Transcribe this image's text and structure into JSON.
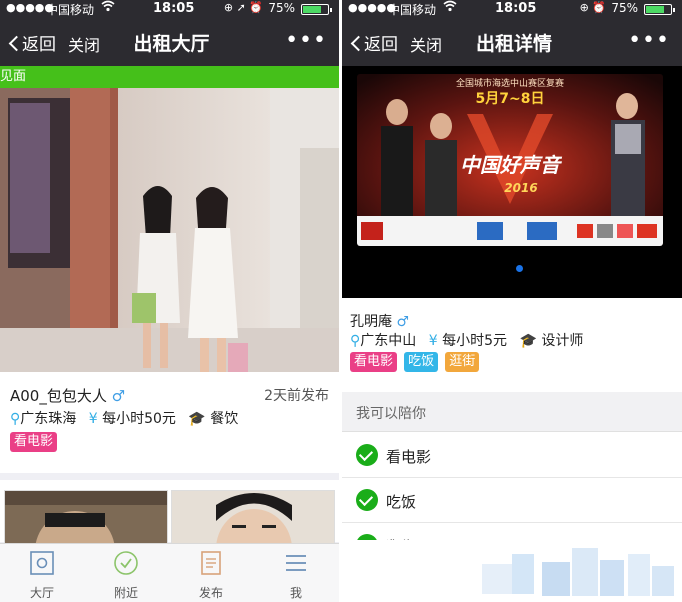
{
  "status_bar": {
    "signal": "●●●●●",
    "carrier": "中国移动",
    "time": "18:05",
    "battery_pct": "75%",
    "battery_level": 0.75
  },
  "left": {
    "nav": {
      "back": "返回",
      "close": "关闭",
      "title": "出租大厅"
    },
    "strip_text": "见面",
    "listing": {
      "name": "A00_包包大人",
      "gender_symbol": "♂",
      "posted": "2天前发布",
      "location": "广东珠海",
      "rate": "每小时50元",
      "job": "餐饮",
      "tags": [
        "看电影"
      ]
    },
    "tabs": [
      {
        "label": "大厅",
        "icon": "hall-icon"
      },
      {
        "label": "附近",
        "icon": "nearby-icon"
      },
      {
        "label": "发布",
        "icon": "publish-icon"
      },
      {
        "label": "我",
        "icon": "profile-icon"
      }
    ]
  },
  "right": {
    "nav": {
      "back": "返回",
      "close": "关闭",
      "title": "出租详情"
    },
    "banner": {
      "caption": "全国城市海选中山赛区复赛",
      "date": "5月7~8日",
      "logo": "中国好声音",
      "year": "2016"
    },
    "profile": {
      "name": "孔明庵",
      "gender_symbol": "♂",
      "location": "广东中山",
      "rate": "每小时5元",
      "job": "设计师",
      "tags": [
        "看电影",
        "吃饭",
        "逛街"
      ]
    },
    "section_title": "我可以陪你",
    "options": [
      "看电影",
      "吃饭",
      "逛街"
    ]
  },
  "colors": {
    "nav_bg": "#2c2b30",
    "green": "#45c01a",
    "check_green": "#1aad19",
    "accent_blue": "#32aee5",
    "tag_pink": "#ea3f86",
    "tag_blue": "#33b6e8",
    "tag_orange": "#f2a73c"
  }
}
